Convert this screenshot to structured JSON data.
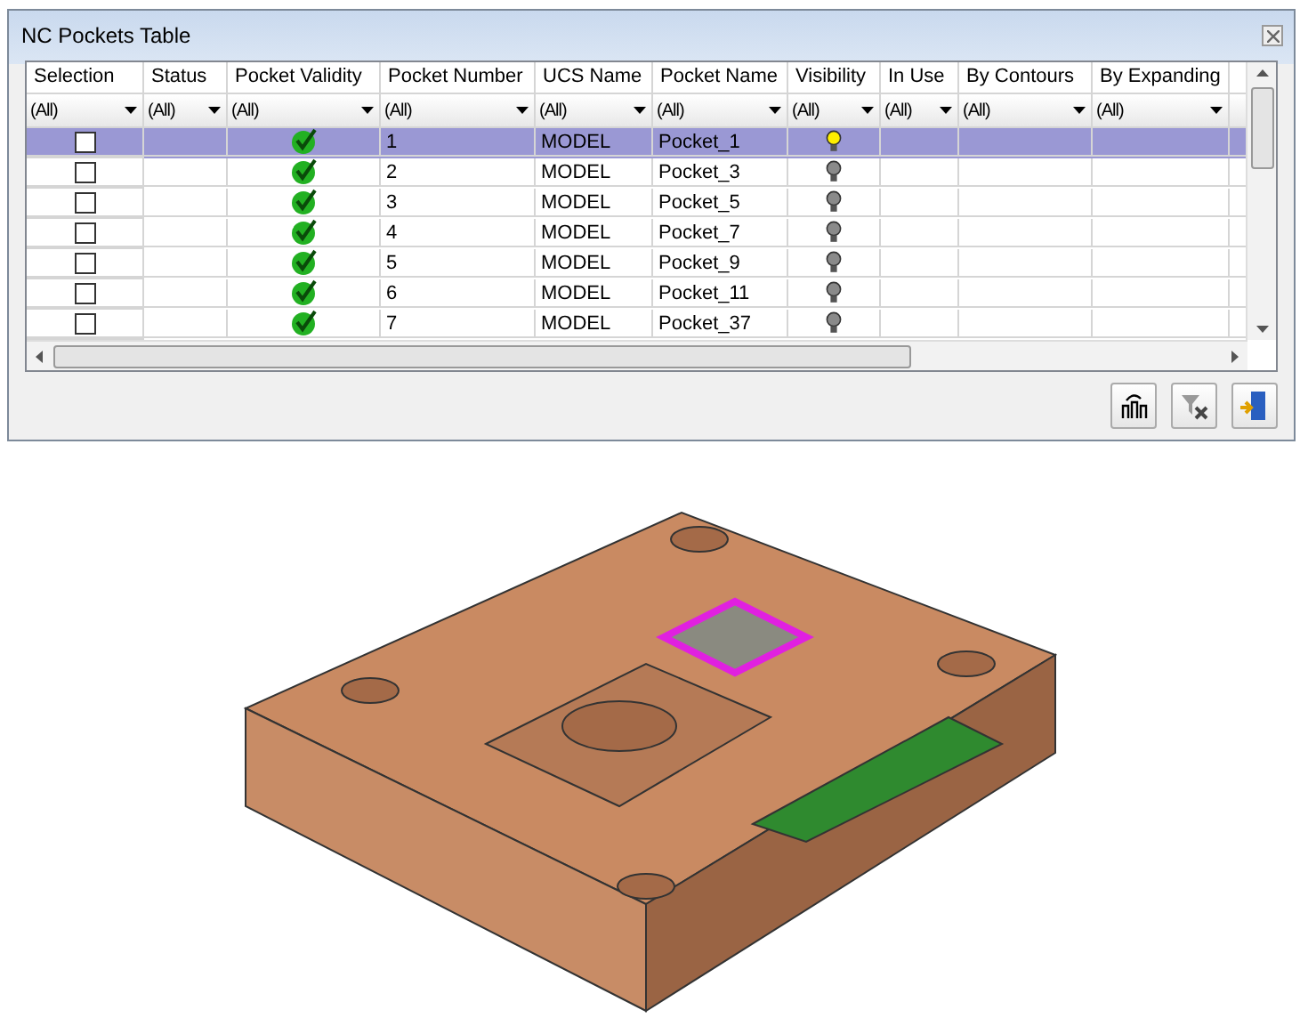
{
  "window": {
    "title": "NC Pockets Table"
  },
  "table": {
    "columns": [
      "Selection",
      "Status",
      "Pocket Validity",
      "Pocket Number",
      "UCS Name",
      "Pocket Name",
      "Visibility",
      "In Use",
      "By Contours",
      "By Expanding"
    ],
    "filters": [
      "(All)",
      "(All)",
      "(All)",
      "(All)",
      "(All)",
      "(All)",
      "(All)",
      "(All)",
      "(All)",
      "(All)"
    ],
    "rows": [
      {
        "selected": true,
        "checked": false,
        "valid": true,
        "number": "1",
        "ucs": "MODEL",
        "name": "Pocket_1",
        "visible": true
      },
      {
        "selected": false,
        "checked": false,
        "valid": true,
        "number": "2",
        "ucs": "MODEL",
        "name": "Pocket_3",
        "visible": false
      },
      {
        "selected": false,
        "checked": false,
        "valid": true,
        "number": "3",
        "ucs": "MODEL",
        "name": "Pocket_5",
        "visible": false
      },
      {
        "selected": false,
        "checked": false,
        "valid": true,
        "number": "4",
        "ucs": "MODEL",
        "name": "Pocket_7",
        "visible": false
      },
      {
        "selected": false,
        "checked": false,
        "valid": true,
        "number": "5",
        "ucs": "MODEL",
        "name": "Pocket_9",
        "visible": false
      },
      {
        "selected": false,
        "checked": false,
        "valid": true,
        "number": "6",
        "ucs": "MODEL",
        "name": "Pocket_11",
        "visible": false
      },
      {
        "selected": false,
        "checked": false,
        "valid": true,
        "number": "7",
        "ucs": "MODEL",
        "name": "Pocket_37",
        "visible": false
      }
    ]
  }
}
